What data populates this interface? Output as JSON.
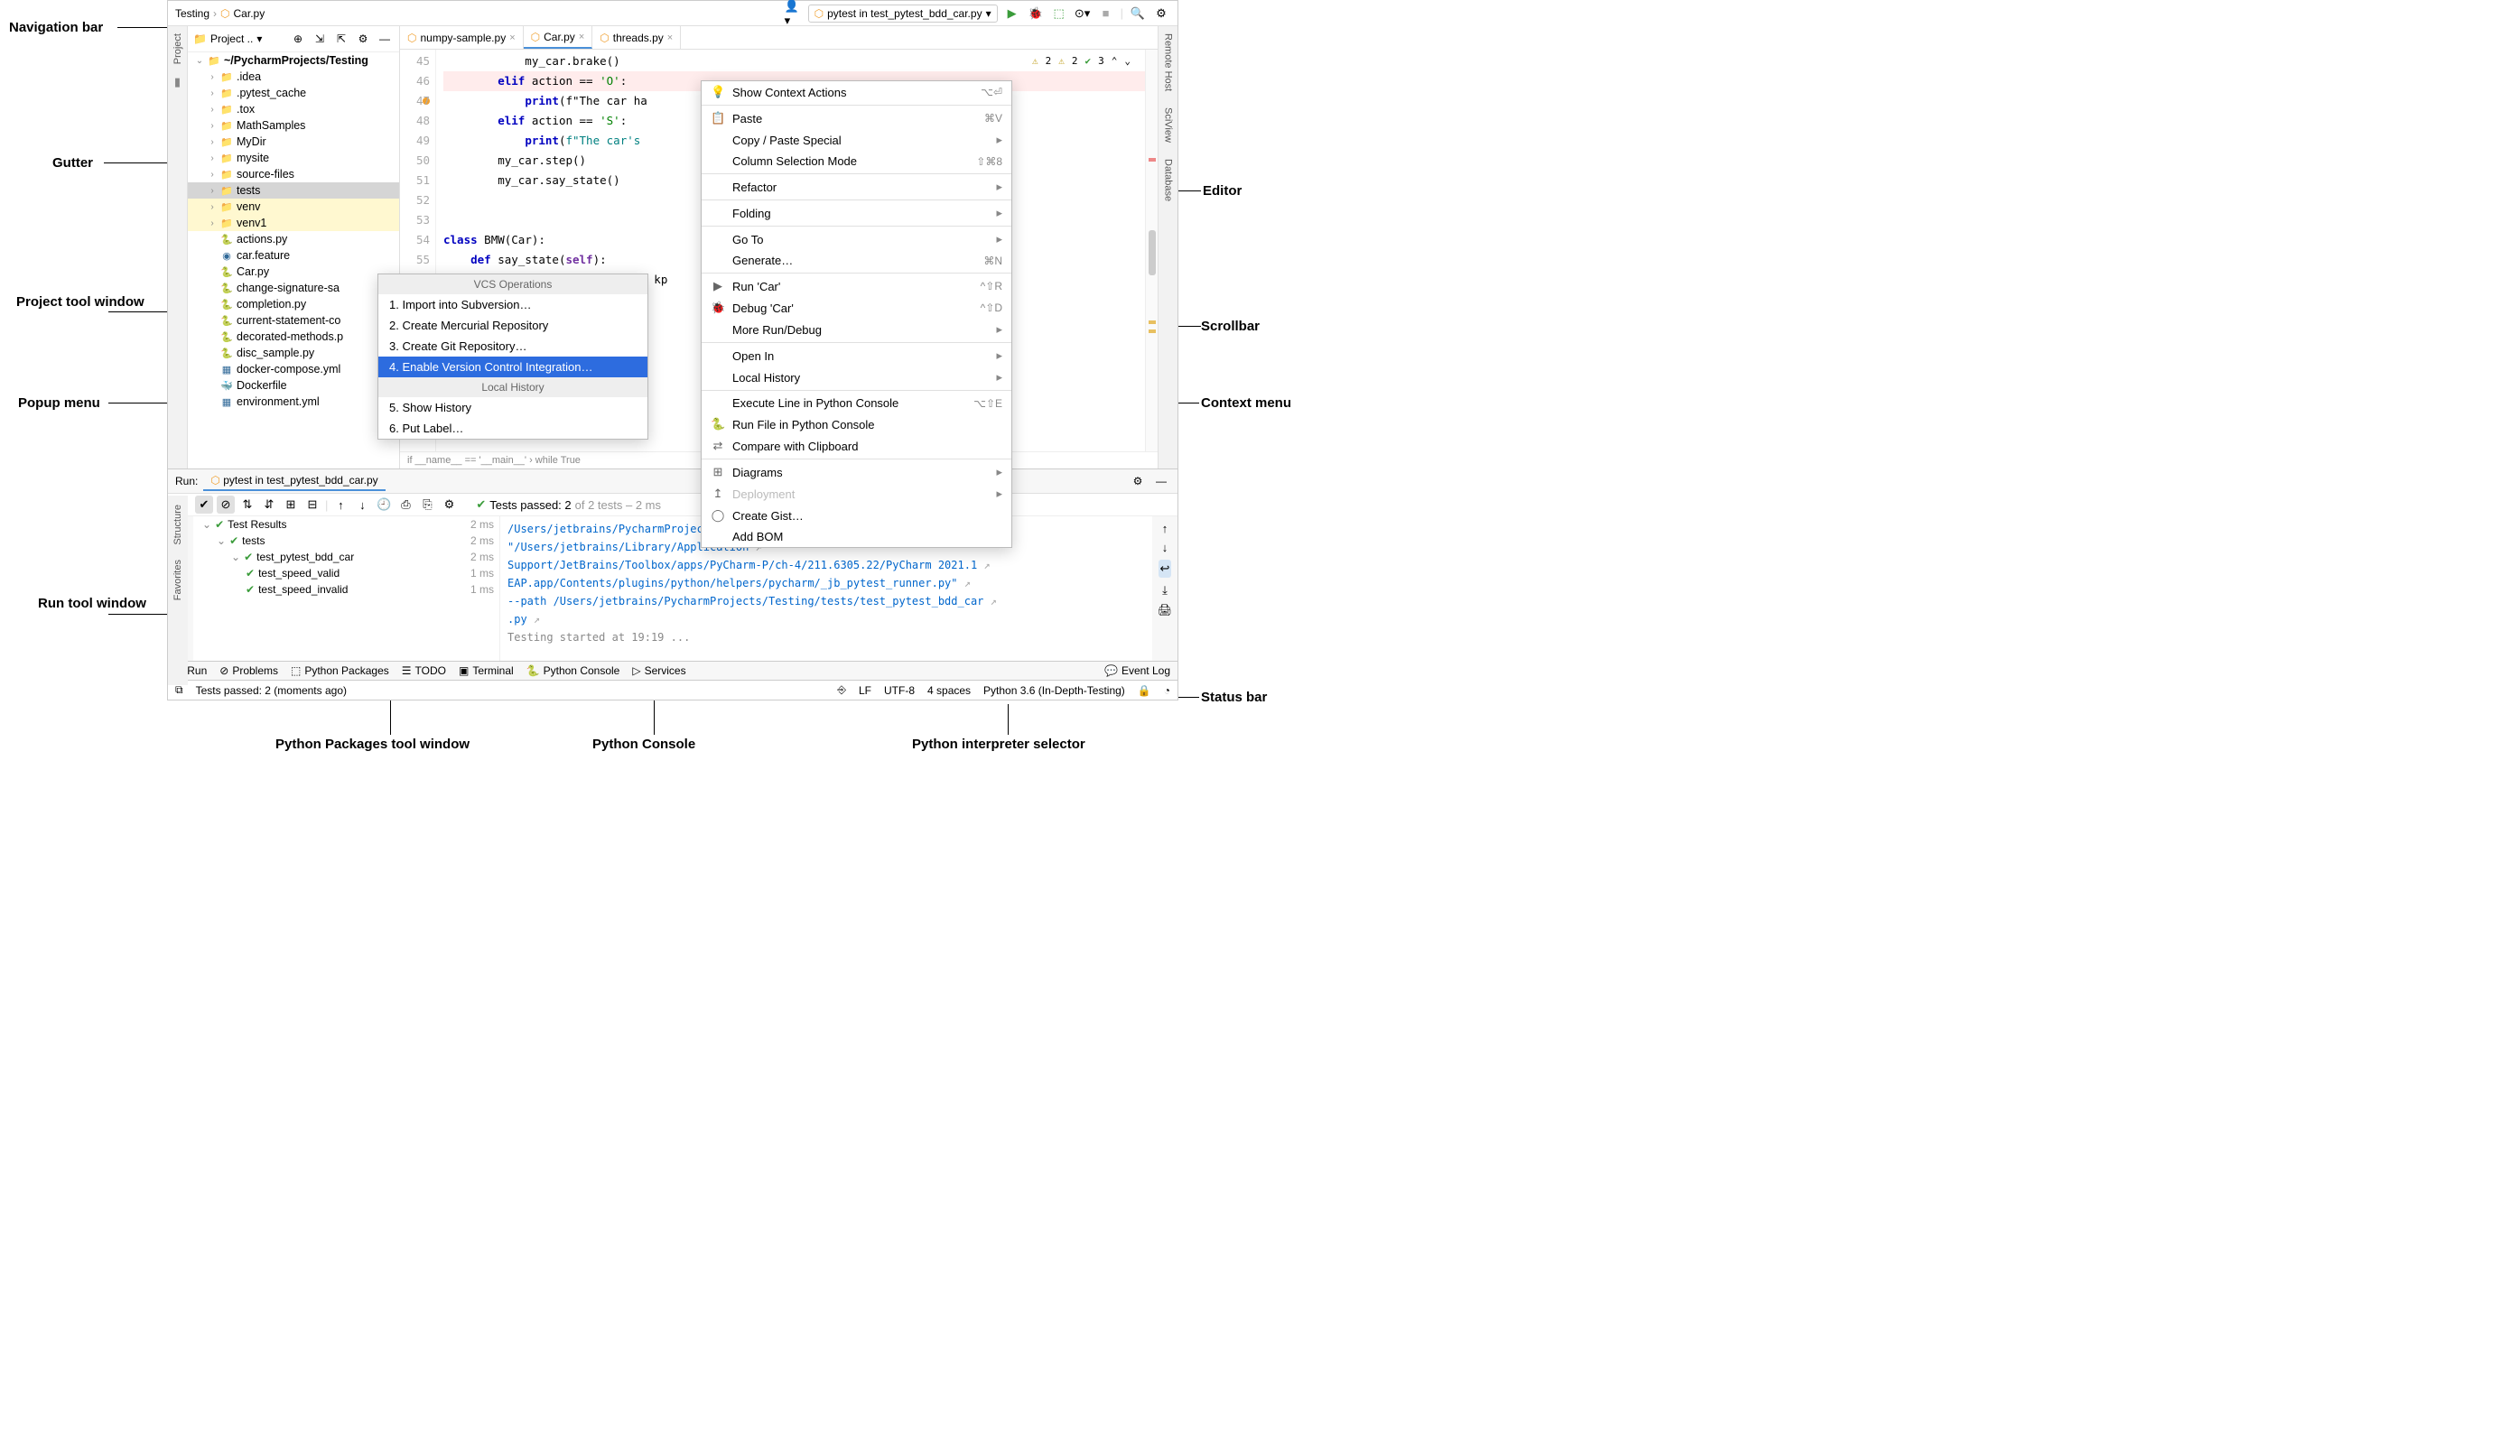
{
  "breadcrumb": {
    "root": "Testing",
    "file": "Car.py"
  },
  "run_config": "pytest in test_pytest_bdd_car.py",
  "left_tabs": [
    "Project"
  ],
  "right_tabs": [
    "Remote Host",
    "SciView",
    "Database"
  ],
  "project_header": "Project ..",
  "tree": [
    {
      "d": 0,
      "arrow": "v",
      "icon": "folder-root",
      "label": "~/PycharmProjects/Testing",
      "bold": true
    },
    {
      "d": 1,
      "arrow": ">",
      "icon": "folder",
      "label": ".idea"
    },
    {
      "d": 1,
      "arrow": ">",
      "icon": "folder",
      "label": ".pytest_cache"
    },
    {
      "d": 1,
      "arrow": ">",
      "icon": "folder",
      "label": ".tox"
    },
    {
      "d": 1,
      "arrow": ">",
      "icon": "folder",
      "label": "MathSamples"
    },
    {
      "d": 1,
      "arrow": ">",
      "icon": "folder",
      "label": "MyDir"
    },
    {
      "d": 1,
      "arrow": ">",
      "icon": "folder",
      "label": "mysite"
    },
    {
      "d": 1,
      "arrow": ">",
      "icon": "folder-b",
      "label": "source-files"
    },
    {
      "d": 1,
      "arrow": ">",
      "icon": "folder-b",
      "label": "tests",
      "sel": true
    },
    {
      "d": 1,
      "arrow": ">",
      "icon": "folder-o",
      "label": "venv",
      "hl": true
    },
    {
      "d": 1,
      "arrow": ">",
      "icon": "folder-o",
      "label": "venv1",
      "hl": true
    },
    {
      "d": 1,
      "arrow": "",
      "icon": "py",
      "label": "actions.py"
    },
    {
      "d": 1,
      "arrow": "",
      "icon": "feature",
      "label": "car.feature"
    },
    {
      "d": 1,
      "arrow": "",
      "icon": "py",
      "label": "Car.py"
    },
    {
      "d": 1,
      "arrow": "",
      "icon": "py",
      "label": "change-signature-sa"
    },
    {
      "d": 1,
      "arrow": "",
      "icon": "py",
      "label": "completion.py"
    },
    {
      "d": 1,
      "arrow": "",
      "icon": "py",
      "label": "current-statement-co"
    },
    {
      "d": 1,
      "arrow": "",
      "icon": "py",
      "label": "decorated-methods.p"
    },
    {
      "d": 1,
      "arrow": "",
      "icon": "py",
      "label": "disc_sample.py"
    },
    {
      "d": 1,
      "arrow": "",
      "icon": "yml",
      "label": "docker-compose.yml"
    },
    {
      "d": 1,
      "arrow": "",
      "icon": "docker",
      "label": "Dockerfile"
    },
    {
      "d": 1,
      "arrow": "",
      "icon": "yml",
      "label": "environment.yml"
    }
  ],
  "editor_tabs": [
    {
      "label": "numpy-sample.py",
      "icon": "py"
    },
    {
      "label": "Car.py",
      "icon": "py",
      "active": true
    },
    {
      "label": "threads.py",
      "icon": "py"
    }
  ],
  "gutter_start": 45,
  "code_lines": [
    "            my_car.brake()",
    "        elif action == 'O':",
    "            print(f\"The car ha",
    "        elif action == 'S':",
    "            print(f\"The car's                              kph\")",
    "        my_car.step()",
    "        my_car.say_state()",
    "",
    "",
    "class BMW(Car):",
    "    def say_state(self):",
    "                            {} kp"
  ],
  "breakpoint_line": 46,
  "inspections": {
    "warn1": "2",
    "warn2": "2",
    "ok": "3"
  },
  "editor_crumbs": "if __name__ == '__main__'  ›  while True",
  "popup": {
    "title": "VCS Operations",
    "items": [
      "1. Import into Subversion…",
      "2. Create Mercurial Repository",
      "3. Create Git Repository…",
      "4. Enable Version Control Integration…"
    ],
    "selected_index": 3,
    "section2_title": "Local History",
    "items2": [
      "5. Show History",
      "6. Put Label…"
    ]
  },
  "context_menu": [
    {
      "icon": "bulb",
      "label": "Show Context Actions",
      "sc": "⌥⏎"
    },
    {
      "sep": true
    },
    {
      "icon": "paste",
      "label": "Paste",
      "sc": "⌘V"
    },
    {
      "label": "Copy / Paste Special",
      "sub": true
    },
    {
      "label": "Column Selection Mode",
      "sc": "⇧⌘8"
    },
    {
      "sep": true
    },
    {
      "label": "Refactor",
      "sub": true
    },
    {
      "sep": true
    },
    {
      "label": "Folding",
      "sub": true
    },
    {
      "sep": true
    },
    {
      "label": "Go To",
      "sub": true
    },
    {
      "label": "Generate…",
      "sc": "⌘N"
    },
    {
      "sep": true
    },
    {
      "icon": "run",
      "label": "Run 'Car'",
      "sc": "^⇧R"
    },
    {
      "icon": "debug",
      "label": "Debug 'Car'",
      "sc": "^⇧D"
    },
    {
      "label": "More Run/Debug",
      "sub": true
    },
    {
      "sep": true
    },
    {
      "label": "Open In",
      "sub": true
    },
    {
      "label": "Local History",
      "sub": true
    },
    {
      "sep": true
    },
    {
      "label": "Execute Line in Python Console",
      "sc": "⌥⇧E"
    },
    {
      "icon": "pyc",
      "label": "Run File in Python Console"
    },
    {
      "icon": "diff",
      "label": "Compare with Clipboard"
    },
    {
      "sep": true
    },
    {
      "icon": "diag",
      "label": "Diagrams",
      "sub": true
    },
    {
      "icon": "deploy",
      "label": "Deployment",
      "sub": true,
      "dis": true
    },
    {
      "icon": "gh",
      "label": "Create Gist…"
    },
    {
      "label": "Add BOM"
    }
  ],
  "run": {
    "label": "Run:",
    "tab": "pytest in test_pytest_bdd_car.py",
    "status": "Tests passed: 2",
    "status_tail": " of 2 tests – 2 ms",
    "tree": [
      {
        "d": 0,
        "label": "Test Results",
        "time": "2 ms",
        "pass": true,
        "arrow": "v"
      },
      {
        "d": 1,
        "label": "tests",
        "time": "2 ms",
        "pass": true,
        "arrow": "v"
      },
      {
        "d": 2,
        "label": "test_pytest_bdd_car",
        "time": "2 ms",
        "pass": true,
        "arrow": "v"
      },
      {
        "d": 3,
        "label": "test_speed_valid",
        "time": "1 ms",
        "pass": true
      },
      {
        "d": 3,
        "label": "test_speed_invalid",
        "time": "1 ms",
        "pass": true
      }
    ],
    "console": [
      {
        "t": "/Users/jetbrains/PycharmProjects/In-Depth-Testing/venv/bin/python",
        "c": "b"
      },
      {
        "t": "\"/Users/jetbrains/Library/Application",
        "c": "b"
      },
      {
        "t": "Support/JetBrains/Toolbox/apps/PyCharm-P/ch-4/211.6305.22/PyCharm 2021.1",
        "c": "b"
      },
      {
        "t": "EAP.app/Contents/plugins/python/helpers/pycharm/_jb_pytest_runner.py\"",
        "c": "b"
      },
      {
        "t": "--path /Users/jetbrains/PycharmProjects/Testing/tests/test_pytest_bdd_car",
        "c": "b"
      },
      {
        "t": ".py",
        "c": "b"
      },
      {
        "t": "Testing started at 19:19 ...",
        "c": "g"
      }
    ]
  },
  "bottom_buttons": [
    {
      "icon": "run",
      "label": "Run"
    },
    {
      "icon": "prob",
      "label": "Problems"
    },
    {
      "icon": "pkg",
      "label": "Python Packages"
    },
    {
      "icon": "todo",
      "label": "TODO"
    },
    {
      "icon": "term",
      "label": "Terminal"
    },
    {
      "icon": "pyc",
      "label": "Python Console"
    },
    {
      "icon": "srv",
      "label": "Services"
    }
  ],
  "event_log": "Event Log",
  "status": {
    "msg": "Tests passed: 2 (moments ago)",
    "lf": "LF",
    "enc": "UTF-8",
    "indent": "4 spaces",
    "interpreter": "Python 3.6 (In-Depth-Testing)"
  },
  "annotations": {
    "nav": "Navigation bar",
    "gutter": "Gutter",
    "proj": "Project tool window",
    "popup": "Popup menu",
    "run": "Run tool window",
    "editor": "Editor",
    "scroll": "Scrollbar",
    "ctx": "Context menu",
    "status": "Status bar",
    "pkg": "Python Packages tool window",
    "pycon": "Python Console",
    "interp": "Python interpreter selector"
  },
  "side_strips": {
    "structure": "Structure",
    "favorites": "Favorites"
  }
}
